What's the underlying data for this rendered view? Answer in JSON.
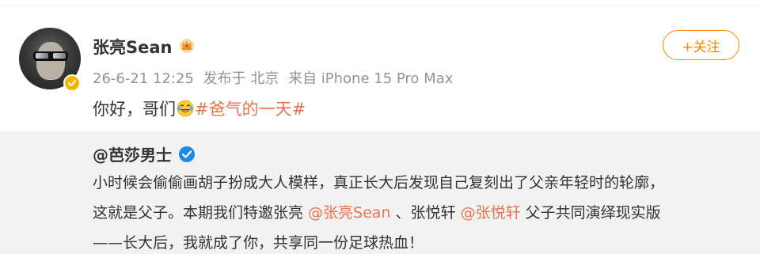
{
  "post": {
    "username": "张亮Sean",
    "timestamp": "26-6-21 12:25",
    "location": "发布于 北京",
    "device": "来自 iPhone 15 Pro Max",
    "follow_label": "+关注",
    "text_before": "你好，哥们",
    "emoji": "laughing-crying-emoji",
    "topic": "#爸气的一天#"
  },
  "repost": {
    "author": "@芭莎男士",
    "line1": "小时候会偷偷画胡子扮成大人模样，真正长大后发现自己复刻出了父亲年轻时的轮廓，",
    "line2_a": "这就是父子。本期我们特邀张亮 ",
    "line2_mention1": "@张亮Sean",
    "line2_b": " 、张悦轩 ",
    "line2_mention2": "@张悦轩",
    "line2_c": " 父子共同演绎现实版",
    "line3": "——长大后，我就成了你，共享同一份足球热血！"
  },
  "colors": {
    "accent": "#ff8200",
    "link": "#eb7350",
    "meta": "#939393",
    "repost_bg": "#f2f2f2",
    "verified_gold": "#f7b500",
    "verified_blue": "#1e88e5"
  },
  "icons": {
    "avatar_badge": "verified-gold-icon",
    "name_badge": "crown-icon",
    "repost_badge": "blue-v-icon"
  }
}
